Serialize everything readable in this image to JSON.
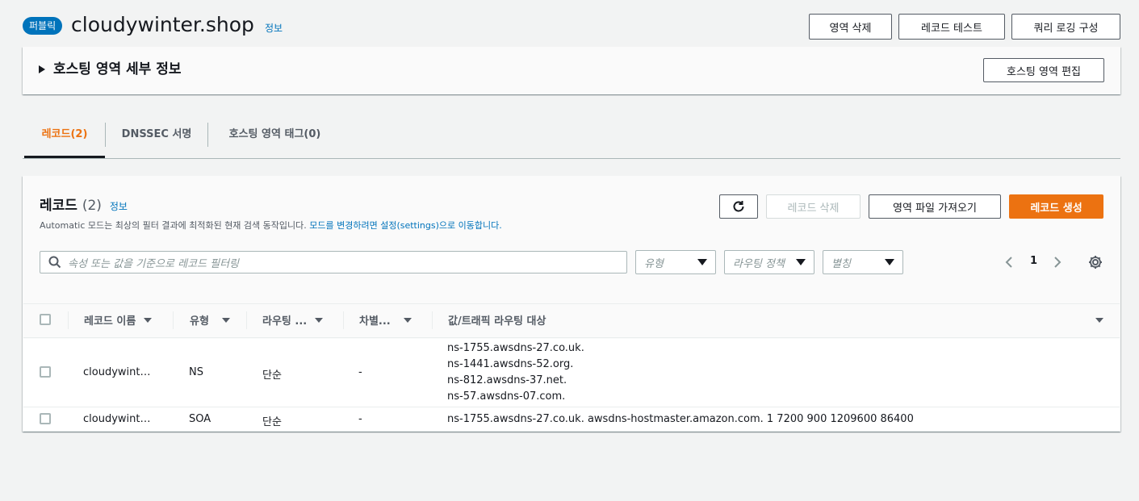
{
  "header": {
    "badge": "퍼블릭",
    "zone_name": "cloudywinter.shop",
    "info": "정보",
    "buttons": {
      "delete_zone": "영역 삭제",
      "test_record": "레코드 테스트",
      "query_logging": "쿼리 로깅 구성"
    }
  },
  "details": {
    "title": "호스팅 영역 세부 정보",
    "edit_button": "호스팅 영역 편집"
  },
  "tabs": [
    {
      "label": "레코드(2)",
      "active": true
    },
    {
      "label": "DNSSEC 서명",
      "active": false
    },
    {
      "label": "호스팅 영역 태그(0)",
      "active": false
    }
  ],
  "records": {
    "title": "레코드",
    "count": "(2)",
    "info": "정보",
    "desc_plain": "Automatic 모드는 최상의 필터 결과에 최적화된 현재 검색 동작입니다.",
    "desc_link": "모드를 변경하려면 설정(settings)으로 이동합니다.",
    "buttons": {
      "delete": "레코드 삭제",
      "import": "영역 파일 가져오기",
      "create": "레코드 생성"
    },
    "search_placeholder": "속성 또는 값을 기준으로 레코드 필터링",
    "filters": {
      "type": "유형",
      "routing": "라우팅 정책",
      "alias": "별칭"
    },
    "page": "1",
    "columns": {
      "name": "레코드 이름",
      "type": "유형",
      "routing": "라우팅 ...",
      "differentiator": "차별...",
      "value": "값/트래픽 라우팅 대상"
    },
    "rows": [
      {
        "name": "cloudywint…",
        "type": "NS",
        "routing": "단순",
        "differentiator": "-",
        "values": [
          "ns-1755.awsdns-27.co.uk.",
          "ns-1441.awsdns-52.org.",
          "ns-812.awsdns-37.net.",
          "ns-57.awsdns-07.com."
        ]
      },
      {
        "name": "cloudywint…",
        "type": "SOA",
        "routing": "단순",
        "differentiator": "-",
        "values": [
          "ns-1755.awsdns-27.co.uk. awsdns-hostmaster.amazon.com. 1 7200 900 1209600 86400"
        ]
      }
    ]
  },
  "colors": {
    "accent": "#ec7211",
    "link": "#0073bb",
    "badge": "#0073bb"
  }
}
